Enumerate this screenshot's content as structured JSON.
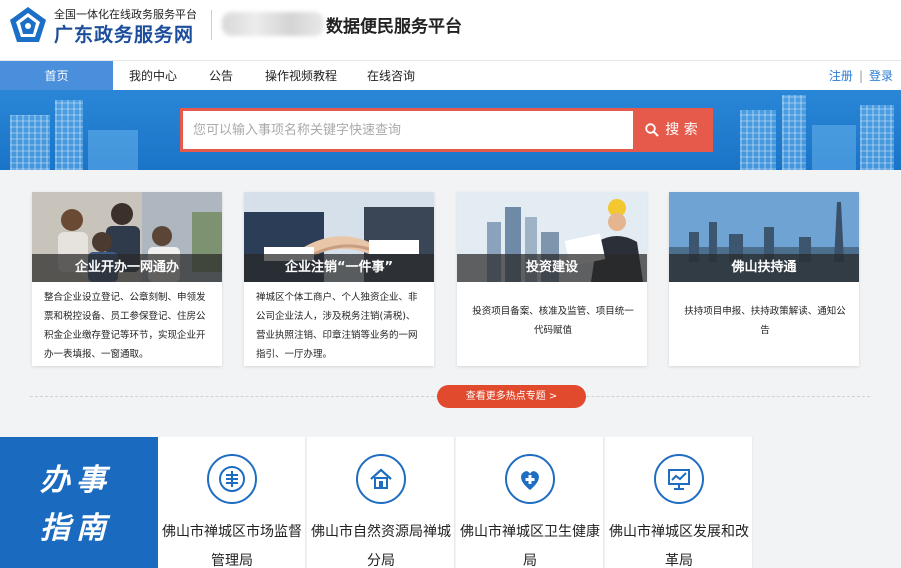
{
  "header": {
    "logo_small": "全国一体化在线政务服务平台",
    "logo_big": "广东政务服务网",
    "platform_title": "数据便民服务平台"
  },
  "nav": {
    "items": [
      {
        "label": "首页",
        "active": true
      },
      {
        "label": "我的中心",
        "active": false
      },
      {
        "label": "公告",
        "active": false
      },
      {
        "label": "操作视频教程",
        "active": false
      },
      {
        "label": "在线咨询",
        "active": false
      }
    ],
    "register": "注册",
    "separator": "|",
    "login": "登录"
  },
  "search": {
    "placeholder": "您可以输入事项名称关键字快速查询",
    "value": "",
    "button_label": "搜 索"
  },
  "cards": [
    {
      "title": "企业开办一网通办",
      "desc": "整合企业设立登记、公章刻制、申领发票和税控设备、员工参保登记、住房公积金企业缴存登记等环节，实现企业开办一表填报、一窗通取。"
    },
    {
      "title": "企业注销“一件事”",
      "desc": "禅城区个体工商户、个人独资企业、非公司企业法人，涉及税务注销(清税)、营业执照注销、印章注销等业务的一网指引、一厅办理。"
    },
    {
      "title": "投资建设",
      "desc": "投资项目备案、核准及监管、项目统一代码赋值"
    },
    {
      "title": "佛山扶持通",
      "desc": "扶持项目申报、扶持政策解读、通知公告"
    }
  ],
  "more_button": "查看更多热点专题 >",
  "guide": {
    "title": "办事指南",
    "departments": [
      {
        "name": "佛山市禅城区市场监督管理局",
        "icon": "market-supervision-icon"
      },
      {
        "name": "佛山市自然资源局禅城分局",
        "icon": "house-icon"
      },
      {
        "name": "佛山市禅城区卫生健康局",
        "icon": "health-icon"
      },
      {
        "name": "佛山市禅城区发展和改革局",
        "icon": "chart-board-icon"
      }
    ]
  },
  "colors": {
    "brand_blue": "#1a6bc0",
    "nav_active": "#4a8fdc",
    "search_red": "#e65a4c",
    "more_red": "#e24a2e"
  }
}
